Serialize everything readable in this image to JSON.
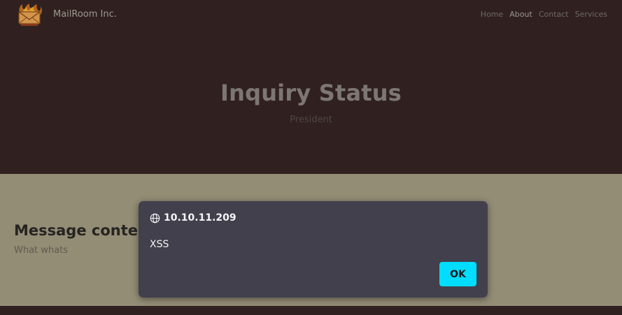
{
  "brand": {
    "name": "MailRoom Inc.",
    "logo_icon": "envelope-flame-logo"
  },
  "nav": {
    "items": [
      {
        "label": "Home",
        "active": false
      },
      {
        "label": "About",
        "active": true
      },
      {
        "label": "Contact",
        "active": false
      },
      {
        "label": "Services",
        "active": false
      }
    ]
  },
  "hero": {
    "title": "Inquiry Status",
    "subtitle": "President"
  },
  "content": {
    "heading": "Message contents",
    "text": "What whats"
  },
  "dialog": {
    "origin": "10.10.11.209",
    "origin_icon": "globe-icon",
    "message": "XSS",
    "ok_label": "OK"
  },
  "colors": {
    "hero_bg": "#302120",
    "content_bg": "#938d76",
    "dialog_bg": "#42404d",
    "ok_button": "#00ddff"
  }
}
